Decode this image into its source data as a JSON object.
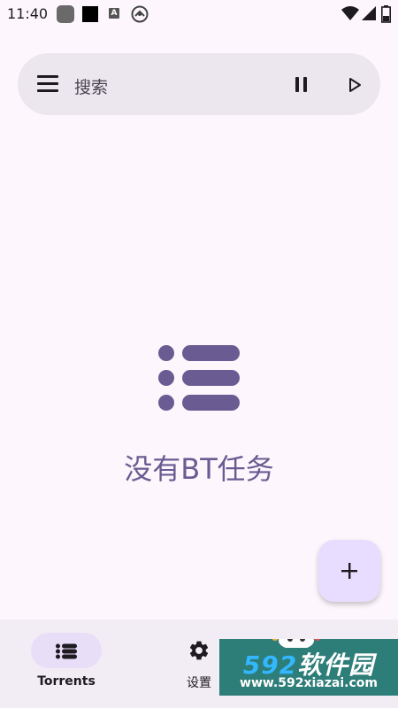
{
  "status_bar": {
    "time": "11:40",
    "icons": [
      "app-icon",
      "black-square-icon",
      "a-icon",
      "circle-icon",
      "wifi-icon",
      "signal-icon",
      "battery-icon"
    ]
  },
  "search_bar": {
    "placeholder": "搜索",
    "icons": [
      "menu-icon",
      "pause-icon",
      "play-icon"
    ]
  },
  "empty_state": {
    "message": "没有BT任务",
    "icon": "list-icon"
  },
  "fab": {
    "icon": "plus-icon"
  },
  "bottom_nav": {
    "items": [
      {
        "label": "Torrents",
        "icon": "list-icon",
        "active": true
      },
      {
        "label": "设置",
        "icon": "gear-icon",
        "active": false
      }
    ]
  },
  "watermark": {
    "logo_number": "592",
    "logo_text": "软件园",
    "url": "www.592xiazai.com"
  },
  "colors": {
    "background": "#fdf7fd",
    "search_bar": "#ece6ee",
    "accent": "#6a5b92",
    "fab": "#e9ddff",
    "nav_pill": "#e8def8",
    "nav_bg": "#f2ecf4"
  }
}
